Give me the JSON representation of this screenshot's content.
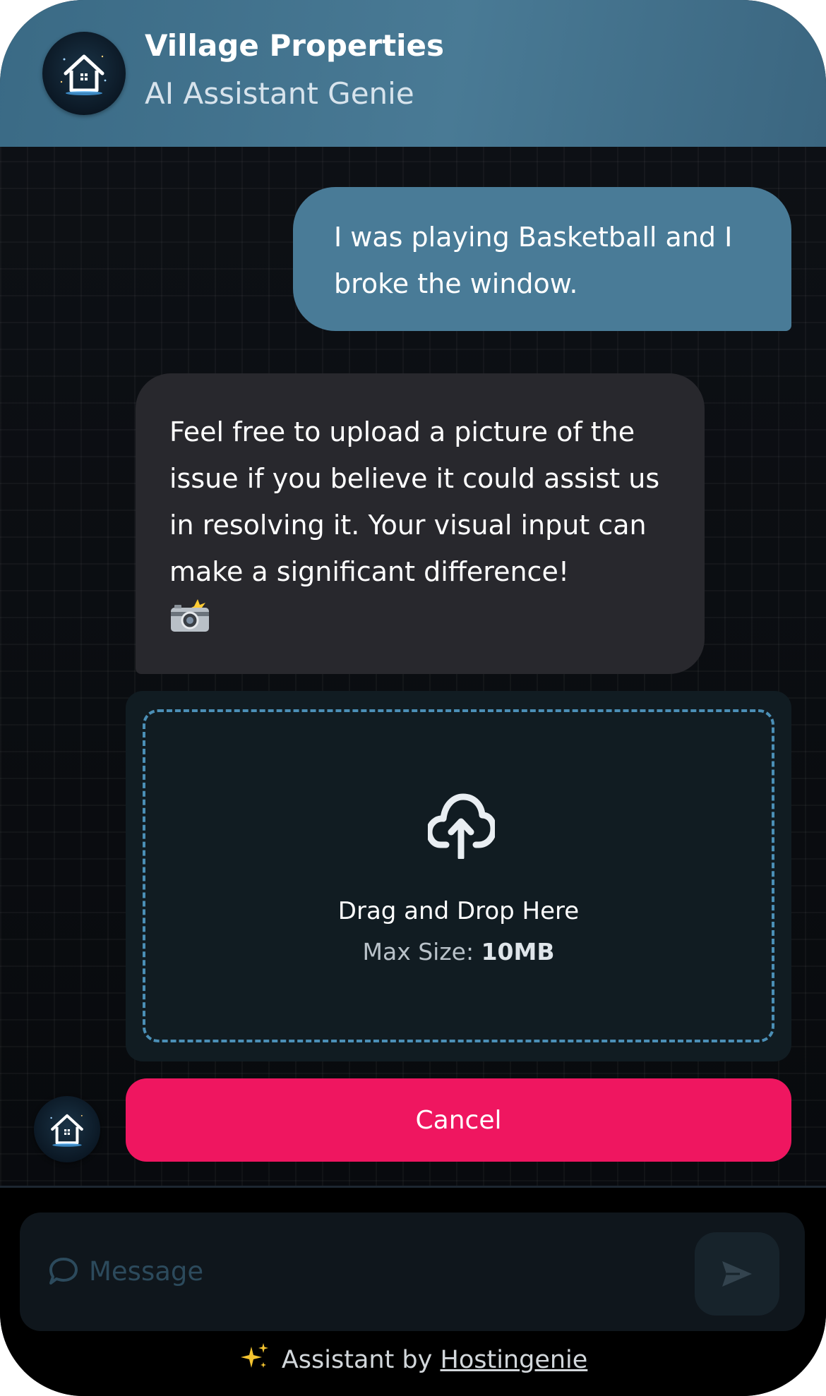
{
  "header": {
    "title": "Village Properties",
    "subtitle": "AI Assistant Genie",
    "avatar_icon": "house-logo-icon",
    "background": "#497b97"
  },
  "messages": [
    {
      "role": "user",
      "text": "I was playing Basketball and I broke the window."
    },
    {
      "role": "assistant",
      "text": "Feel free to upload a picture of the issue if you believe it could assist us in resolving it. Your visual input can make a significant difference!",
      "emoji": "camera-flash-icon"
    }
  ],
  "upload": {
    "icon": "cloud-upload-icon",
    "label": "Drag and Drop Here",
    "max_size_label": "Max Size:",
    "max_size_value": "10MB"
  },
  "cancel_button": {
    "label": "Cancel",
    "color": "#ef1660"
  },
  "composer": {
    "placeholder": "Message",
    "icon": "chat-bubble-icon",
    "send_icon": "send-icon"
  },
  "footer": {
    "prefix": "Assistant by",
    "link": "Hostingenie",
    "icon": "sparkles-icon"
  }
}
